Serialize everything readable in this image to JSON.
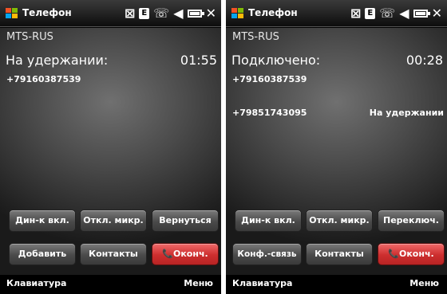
{
  "colors": {
    "screen_bg": "#000000",
    "end_call": "#cc2e2e",
    "button": "#5a5a5a"
  },
  "screens": [
    {
      "app_title": "Телефон",
      "carrier": "MTS-RUS",
      "status_icons": [
        "signal-icon",
        "e-data-icon",
        "call-icon",
        "speaker-icon",
        "battery-icon",
        "close-icon"
      ],
      "call_state": "На удержании:",
      "timer": "01:55",
      "number": "+79160387539",
      "buttons_row1": [
        "Дин-к вкл.",
        "Откл. микр.",
        "Вернуться"
      ],
      "buttons_row2": [
        "Добавить",
        "Контакты",
        "Оконч."
      ],
      "softkey_left": "Клавиатура",
      "softkey_right": "Меню"
    },
    {
      "app_title": "Телефон",
      "carrier": "MTS-RUS",
      "status_icons": [
        "signal-icon",
        "e-data-icon",
        "call-icon",
        "speaker-icon",
        "battery-icon",
        "close-icon"
      ],
      "call_state": "Подключено:",
      "timer": "00:28",
      "number": "+79160387539",
      "second_number": "+79851743095",
      "second_status": "На удержании",
      "buttons_row1": [
        "Дин-к вкл.",
        "Откл. микр.",
        "Переключ."
      ],
      "buttons_row2": [
        "Конф.-связь",
        "Контакты",
        "Оконч."
      ],
      "softkey_left": "Клавиатура",
      "softkey_right": "Меню"
    }
  ]
}
